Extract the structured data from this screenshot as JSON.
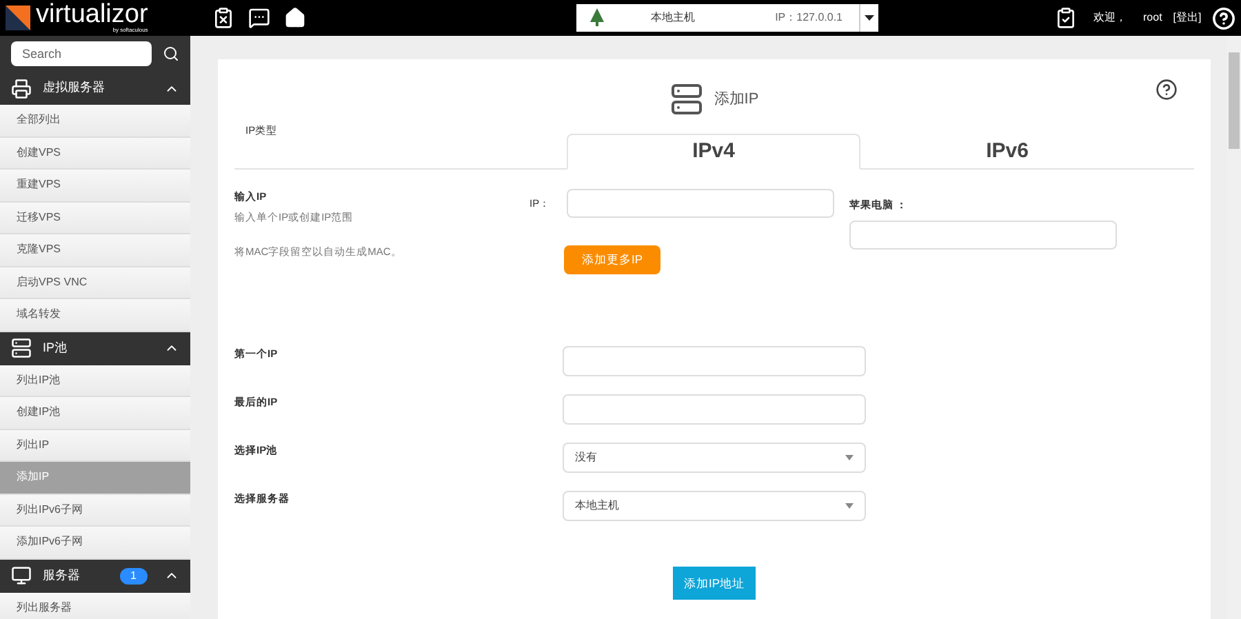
{
  "topbar": {
    "logo": "virtualizor",
    "logo_sub": "by softaculous",
    "server_select": {
      "name": "本地主机",
      "ip": "IP：127.0.0.1"
    },
    "welcome": "欢迎，",
    "user": "root",
    "logout": "[登出]"
  },
  "sidebar": {
    "search": {
      "placeholder": "Search"
    },
    "sections": [
      {
        "title": "虚拟服务器",
        "expanded": true,
        "items": [
          {
            "label": "全部列出",
            "selected": false
          },
          {
            "label": "创建VPS",
            "selected": false
          },
          {
            "label": "重建VPS",
            "selected": false
          },
          {
            "label": "迁移VPS",
            "selected": false
          },
          {
            "label": "克隆VPS",
            "selected": false
          },
          {
            "label": "启动VPS VNC",
            "selected": false
          },
          {
            "label": "域名转发",
            "selected": false
          }
        ]
      },
      {
        "title": "IP池",
        "expanded": true,
        "items": [
          {
            "label": "列出IP池",
            "selected": false
          },
          {
            "label": "创建IP池",
            "selected": false
          },
          {
            "label": "列出IP",
            "selected": false
          },
          {
            "label": "添加IP",
            "selected": true
          },
          {
            "label": "列出IPv6子网",
            "selected": false
          },
          {
            "label": "添加IPv6子网",
            "selected": false
          }
        ]
      },
      {
        "title": "服务器",
        "badge": "1",
        "expanded": true,
        "items": [
          {
            "label": "列出服务器",
            "selected": false
          }
        ]
      }
    ]
  },
  "page": {
    "title": "添加IP",
    "ip_type_label": "IP类型",
    "tabs": [
      {
        "label": "IPv4",
        "selected": true
      },
      {
        "label": "IPv6",
        "selected": false
      }
    ],
    "enter_ip": {
      "label": "输入IP",
      "hint": "输入单个IP或创建IP范围",
      "note": "将MAC字段留空以自动生成MAC。",
      "ip_label": "IP：",
      "mac_label": "苹果电脑 ："
    },
    "add_more_button": "添加更多IP",
    "range_fields": [
      {
        "label": "第一个IP",
        "kind": "input"
      },
      {
        "label": "最后的IP",
        "kind": "input"
      },
      {
        "label": "选择IP池",
        "kind": "select",
        "value": "没有"
      },
      {
        "label": "选择服务器",
        "kind": "select",
        "value": "本地主机"
      }
    ],
    "submit_button": "添加IP地址"
  }
}
